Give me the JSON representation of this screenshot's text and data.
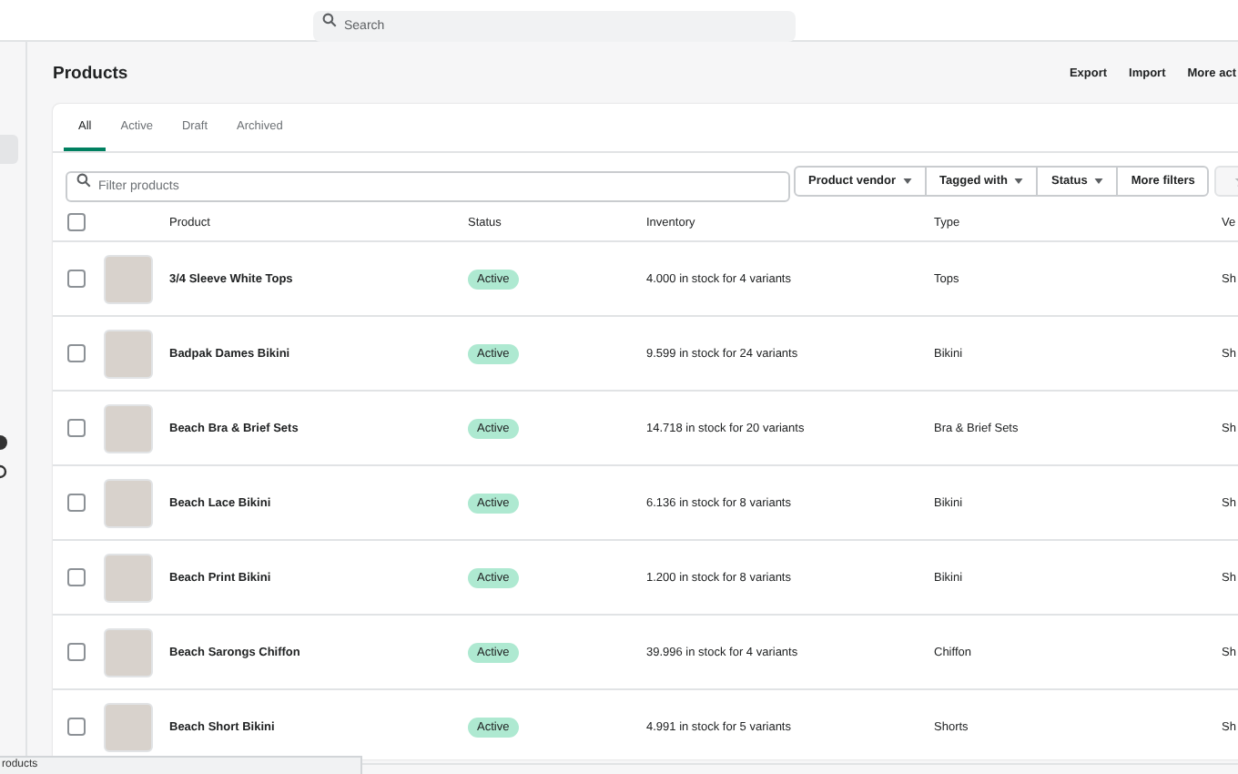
{
  "top_bar": {
    "search": {
      "placeholder": "Search"
    }
  },
  "page": {
    "title": "Products",
    "actions": [
      "Export",
      "Import",
      "More act"
    ]
  },
  "tabs": [
    {
      "label": "All",
      "selected": true
    },
    {
      "label": "Active",
      "selected": false
    },
    {
      "label": "Draft",
      "selected": false
    },
    {
      "label": "Archived",
      "selected": false
    }
  ],
  "filter": {
    "placeholder": "Filter products",
    "buttons": [
      {
        "label": "Product vendor",
        "dropdown": true
      },
      {
        "label": "Tagged with",
        "dropdown": true
      },
      {
        "label": "Status",
        "dropdown": true
      },
      {
        "label": "More filters",
        "dropdown": false
      }
    ]
  },
  "table": {
    "all_selected": false,
    "columns": [
      "Product",
      "Status",
      "Inventory",
      "Type",
      "Ve"
    ],
    "rows": [
      {
        "checked": false,
        "product": "3/4 Sleeve White Tops",
        "status": "Active",
        "inventory": "4.000 in stock for 4 variants",
        "type": "Tops",
        "vendor": "Sh"
      },
      {
        "checked": false,
        "product": "Badpak Dames Bikini",
        "status": "Active",
        "inventory": "9.599 in stock for 24 variants",
        "type": "Bikini",
        "vendor": "Sh"
      },
      {
        "checked": false,
        "product": "Beach Bra & Brief Sets",
        "status": "Active",
        "inventory": "14.718 in stock for 20 variants",
        "type": "Bra & Brief Sets",
        "vendor": "Sh"
      },
      {
        "checked": false,
        "product": "Beach Lace Bikini",
        "status": "Active",
        "inventory": "6.136 in stock for 8 variants",
        "type": "Bikini",
        "vendor": "Sh"
      },
      {
        "checked": false,
        "product": "Beach Print Bikini",
        "status": "Active",
        "inventory": "1.200 in stock for 8 variants",
        "type": "Bikini",
        "vendor": "Sh"
      },
      {
        "checked": false,
        "product": "Beach Sarongs Chiffon",
        "status": "Active",
        "inventory": "39.996 in stock for 4 variants",
        "type": "Chiffon",
        "vendor": "Sh"
      },
      {
        "checked": false,
        "product": "Beach Short Bikini",
        "status": "Active",
        "inventory": "4.991 in stock for 5 variants",
        "type": "Shorts",
        "vendor": "Sh"
      }
    ]
  },
  "status_bar": {
    "text": "roducts"
  }
}
